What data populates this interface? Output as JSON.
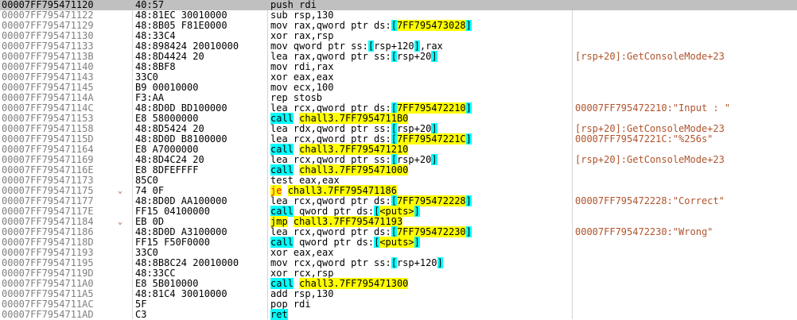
{
  "rows": [
    {
      "addr": "00007FF795471120",
      "bytes": "40:57",
      "arrow": "",
      "comment": "",
      "selected": true,
      "ins": [
        {
          "t": "push rdi"
        }
      ]
    },
    {
      "addr": "00007FF795471122",
      "bytes": "48:81EC 30010000",
      "arrow": "",
      "comment": "",
      "ins": [
        {
          "t": "sub rsp,130"
        }
      ]
    },
    {
      "addr": "00007FF795471129",
      "bytes": "48:8B05 F81E0000",
      "arrow": "",
      "comment": "",
      "ins": [
        {
          "t": "mov rax,qword ptr ds:"
        },
        {
          "t": "[",
          "h": "b"
        },
        {
          "t": "7FF795473028",
          "h": "y"
        },
        {
          "t": "]",
          "h": "b"
        }
      ]
    },
    {
      "addr": "00007FF795471130",
      "bytes": "48:33C4",
      "arrow": "",
      "comment": "",
      "ins": [
        {
          "t": "xor rax,rsp"
        }
      ]
    },
    {
      "addr": "00007FF795471133",
      "bytes": "48:898424 20010000",
      "arrow": "",
      "comment": "",
      "ins": [
        {
          "t": "mov qword ptr ss:"
        },
        {
          "t": "[",
          "h": "b"
        },
        {
          "t": "rsp+120"
        },
        {
          "t": "]",
          "h": "b"
        },
        {
          "t": ",rax"
        }
      ]
    },
    {
      "addr": "00007FF79547113B",
      "bytes": "48:8D4424 20",
      "arrow": "",
      "comment": "[rsp+20]:GetConsoleMode+23",
      "ins": [
        {
          "t": "lea rax,qword ptr ss:"
        },
        {
          "t": "[",
          "h": "b"
        },
        {
          "t": "rsp+20"
        },
        {
          "t": "]",
          "h": "b"
        }
      ]
    },
    {
      "addr": "00007FF795471140",
      "bytes": "48:8BF8",
      "arrow": "",
      "comment": "",
      "ins": [
        {
          "t": "mov rdi,rax"
        }
      ]
    },
    {
      "addr": "00007FF795471143",
      "bytes": "33C0",
      "arrow": "",
      "comment": "",
      "ins": [
        {
          "t": "xor eax,eax"
        }
      ]
    },
    {
      "addr": "00007FF795471145",
      "bytes": "B9 00010000",
      "arrow": "",
      "comment": "",
      "ins": [
        {
          "t": "mov ecx,100"
        }
      ]
    },
    {
      "addr": "00007FF79547114A",
      "bytes": "F3:AA",
      "arrow": "",
      "comment": "",
      "ins": [
        {
          "t": "rep stosb"
        }
      ]
    },
    {
      "addr": "00007FF79547114C",
      "bytes": "48:8D0D BD100000",
      "arrow": "",
      "comment": "00007FF795472210:\"Input : \"",
      "ins": [
        {
          "t": "lea rcx,qword ptr ds:"
        },
        {
          "t": "[",
          "h": "b"
        },
        {
          "t": "7FF795472210",
          "h": "y"
        },
        {
          "t": "]",
          "h": "b"
        }
      ]
    },
    {
      "addr": "00007FF795471153",
      "bytes": "E8 58000000",
      "arrow": "",
      "comment": "",
      "ins": [
        {
          "t": "call",
          "h": "c"
        },
        {
          "t": " "
        },
        {
          "t": "chall3.7FF7954711B0",
          "h": "y"
        }
      ]
    },
    {
      "addr": "00007FF795471158",
      "bytes": "48:8D5424 20",
      "arrow": "",
      "comment": "[rsp+20]:GetConsoleMode+23",
      "ins": [
        {
          "t": "lea rdx,qword ptr ss:"
        },
        {
          "t": "[",
          "h": "b"
        },
        {
          "t": "rsp+20"
        },
        {
          "t": "]",
          "h": "b"
        }
      ]
    },
    {
      "addr": "00007FF79547115D",
      "bytes": "48:8D0D B8100000",
      "arrow": "",
      "comment": "00007FF79547221C:\"%256s\"",
      "ins": [
        {
          "t": "lea rcx,qword ptr ds:"
        },
        {
          "t": "[",
          "h": "b"
        },
        {
          "t": "7FF79547221C",
          "h": "y"
        },
        {
          "t": "]",
          "h": "b"
        }
      ]
    },
    {
      "addr": "00007FF795471164",
      "bytes": "E8 A7000000",
      "arrow": "",
      "comment": "",
      "ins": [
        {
          "t": "call",
          "h": "c"
        },
        {
          "t": " "
        },
        {
          "t": "chall3.7FF795471210",
          "h": "y"
        }
      ]
    },
    {
      "addr": "00007FF795471169",
      "bytes": "48:8D4C24 20",
      "arrow": "",
      "comment": "[rsp+20]:GetConsoleMode+23",
      "ins": [
        {
          "t": "lea rcx,qword ptr ss:"
        },
        {
          "t": "[",
          "h": "b"
        },
        {
          "t": "rsp+20"
        },
        {
          "t": "]",
          "h": "b"
        }
      ]
    },
    {
      "addr": "00007FF79547116E",
      "bytes": "E8 8DFEFFFF",
      "arrow": "",
      "comment": "",
      "ins": [
        {
          "t": "call",
          "h": "c"
        },
        {
          "t": " "
        },
        {
          "t": "chall3.7FF795471000",
          "h": "y"
        }
      ]
    },
    {
      "addr": "00007FF795471173",
      "bytes": "85C0",
      "arrow": "",
      "comment": "",
      "ins": [
        {
          "t": "test eax,eax"
        }
      ]
    },
    {
      "addr": "00007FF795471175",
      "bytes": "74 0F",
      "arrow": "⌄",
      "comment": "",
      "ins": [
        {
          "t": "je",
          "h": "r"
        },
        {
          "t": " "
        },
        {
          "t": "chall3.7FF795471186",
          "h": "y"
        }
      ]
    },
    {
      "addr": "00007FF795471177",
      "bytes": "48:8D0D AA100000",
      "arrow": "",
      "comment": "00007FF795472228:\"Correct\"",
      "ins": [
        {
          "t": "lea rcx,qword ptr ds:"
        },
        {
          "t": "[",
          "h": "b"
        },
        {
          "t": "7FF795472228",
          "h": "y"
        },
        {
          "t": "]",
          "h": "b"
        }
      ]
    },
    {
      "addr": "00007FF79547117E",
      "bytes": "FF15 04100000",
      "arrow": "",
      "comment": "",
      "ins": [
        {
          "t": "call",
          "h": "c"
        },
        {
          "t": " qword ptr ds:"
        },
        {
          "t": "[",
          "h": "b"
        },
        {
          "t": "<puts>",
          "h": "y"
        },
        {
          "t": "]",
          "h": "b"
        }
      ]
    },
    {
      "addr": "00007FF795471184",
      "bytes": "EB 0D",
      "arrow": "⌄",
      "comment": "",
      "ins": [
        {
          "t": "jmp",
          "h": "y"
        },
        {
          "t": " "
        },
        {
          "t": "chall3.7FF795471193",
          "h": "y"
        }
      ]
    },
    {
      "addr": "00007FF795471186",
      "bytes": "48:8D0D A3100000",
      "arrow": "",
      "comment": "00007FF795472230:\"Wrong\"",
      "ins": [
        {
          "t": "lea rcx,qword ptr ds:"
        },
        {
          "t": "[",
          "h": "b"
        },
        {
          "t": "7FF795472230",
          "h": "y"
        },
        {
          "t": "]",
          "h": "b"
        }
      ]
    },
    {
      "addr": "00007FF79547118D",
      "bytes": "FF15 F50F0000",
      "arrow": "",
      "comment": "",
      "ins": [
        {
          "t": "call",
          "h": "c"
        },
        {
          "t": " qword ptr ds:"
        },
        {
          "t": "[",
          "h": "b"
        },
        {
          "t": "<puts>",
          "h": "y"
        },
        {
          "t": "]",
          "h": "b"
        }
      ]
    },
    {
      "addr": "00007FF795471193",
      "bytes": "33C0",
      "arrow": "",
      "comment": "",
      "ins": [
        {
          "t": "xor eax,eax"
        }
      ]
    },
    {
      "addr": "00007FF795471195",
      "bytes": "48:8B8C24 20010000",
      "arrow": "",
      "comment": "",
      "ins": [
        {
          "t": "mov rcx,qword ptr ss:"
        },
        {
          "t": "[",
          "h": "b"
        },
        {
          "t": "rsp+120"
        },
        {
          "t": "]",
          "h": "b"
        }
      ]
    },
    {
      "addr": "00007FF79547119D",
      "bytes": "48:33CC",
      "arrow": "",
      "comment": "",
      "ins": [
        {
          "t": "xor rcx,rsp"
        }
      ]
    },
    {
      "addr": "00007FF7954711A0",
      "bytes": "E8 5B010000",
      "arrow": "",
      "comment": "",
      "ins": [
        {
          "t": "call",
          "h": "c"
        },
        {
          "t": " "
        },
        {
          "t": "chall3.7FF795471300",
          "h": "y"
        }
      ]
    },
    {
      "addr": "00007FF7954711A5",
      "bytes": "48:81C4 30010000",
      "arrow": "",
      "comment": "",
      "ins": [
        {
          "t": "add rsp,130"
        }
      ]
    },
    {
      "addr": "00007FF7954711AC",
      "bytes": "5F",
      "arrow": "",
      "comment": "",
      "ins": [
        {
          "t": "pop rdi"
        }
      ]
    },
    {
      "addr": "00007FF7954711AD",
      "bytes": "C3",
      "arrow": "",
      "comment": "",
      "ins": [
        {
          "t": "ret",
          "h": "c"
        }
      ]
    }
  ]
}
